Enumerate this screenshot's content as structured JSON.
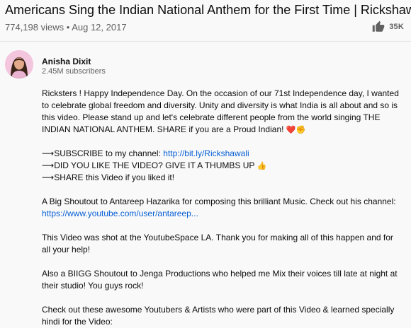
{
  "video": {
    "title": "Americans Sing the Indian National Anthem for the First Time | Rickshawali",
    "views": "774,198 views",
    "date": "Aug 12, 2017",
    "likes": "35K"
  },
  "channel": {
    "name": "Anisha Dixit",
    "subscribers": "2.45M subscribers"
  },
  "description": {
    "para1": "Ricksters ! Happy Independence Day. On the occasion of our 71st Independence day, I wanted to celebrate global freedom and diversity. Unity and diversity is what India is all about and so is this video. Please stand up and let's celebrate different people from the world singing THE INDIAN NATIONAL ANTHEM. SHARE if you are a Proud Indian!",
    "para1_emoji": "❤️✊",
    "subscribe_prefix": "⟶SUBSCRIBE to my channel: ",
    "subscribe_link": "http://bit.ly/Rickshawali",
    "thumbs_line": "⟶DID YOU LIKE THE VIDEO? GIVE IT A THUMBS UP",
    "thumbs_emoji": "👍",
    "share_line": "⟶SHARE this Video if you liked it!",
    "shoutout1": "A Big Shoutout to Antareep Hazarika for composing this brilliant Music. Check out his channel:",
    "shoutout1_link": "https://www.youtube.com/user/antareep...",
    "youtubespace": "This Video was shot at the YoutubeSpace LA. Thank you for making all of this happen and for all your help!",
    "shoutout2": "Also a BIIGG Shoutout to Jenga Productions who helped me Mix their voices till late at night at their studio! You guys rock!",
    "checkout": "Check out these awesome Youtubers & Artists who were part of this Video & learned specially hindi for the Video:"
  },
  "icons": {
    "like": "thumbs-up-icon"
  }
}
